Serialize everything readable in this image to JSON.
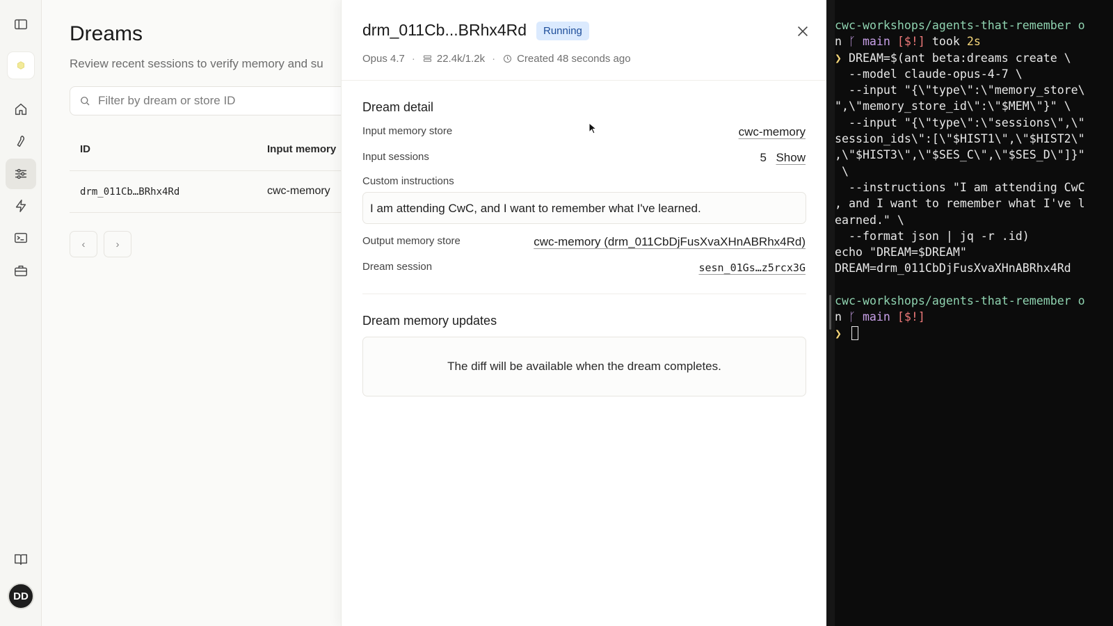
{
  "rail": {
    "items": [
      "sidebar-toggle",
      "logo",
      "home",
      "tools",
      "dreams",
      "bolt",
      "terminal",
      "briefcase",
      "docs"
    ],
    "avatar_initials": "DD"
  },
  "list": {
    "title": "Dreams",
    "subtitle": "Review recent sessions to verify memory and su",
    "search_placeholder": "Filter by dream or store ID",
    "columns": [
      "ID",
      "Input memory"
    ],
    "rows": [
      {
        "id": "drm_011Cb…BRhx4Rd",
        "input_memory": "cwc-memory"
      }
    ],
    "prev_label": "‹",
    "next_label": "›"
  },
  "detail": {
    "title": "drm_011Cb...BRhx4Rd",
    "status": "Running",
    "model": "Opus 4.7",
    "tokens": "22.4k/1.2k",
    "created": "Created 48 seconds ago",
    "section_detail": "Dream detail",
    "input_memory_label": "Input memory store",
    "input_memory_value": "cwc-memory",
    "input_sessions_label": "Input sessions",
    "input_sessions_count": "5",
    "input_sessions_show": "Show",
    "custom_instructions_label": "Custom instructions",
    "custom_instructions_value": "I am attending CwC, and I want to remember what I've learned.",
    "output_memory_label": "Output memory store",
    "output_memory_value": "cwc-memory (drm_011CbDjFusXvaXHnABRhx4Rd)",
    "dream_session_label": "Dream session",
    "dream_session_value": "sesn_01Gs…z5rcx3G",
    "section_updates": "Dream memory updates",
    "diff_message": "The diff will be available when the dream completes."
  },
  "terminal": {
    "prompt_path": "cwc-workshops/agents-that-remember o",
    "prompt_cont": "n ",
    "branch_glyph": "ᚴ",
    "branch": " main ",
    "status": "[$!]",
    "took": " took ",
    "took_time": "2s",
    "arrow": "❯ ",
    "cmd_lines": [
      "DREAM=$(ant beta:dreams create \\",
      "  --model claude-opus-4-7 \\",
      "  --input \"{\\\"type\\\":\\\"memory_store\\",
      "\",\\\"memory_store_id\\\":\\\"$MEM\\\"}\" \\",
      "  --input \"{\\\"type\\\":\\\"sessions\\\",\\\"",
      "session_ids\\\":[\\\"$HIST1\\\",\\\"$HIST2\\\"",
      ",\\\"$HIST3\\\",\\\"$SES_C\\\",\\\"$SES_D\\\"]}\"",
      " \\",
      "  --instructions \"I am attending CwC",
      ", and I want to remember what I've l",
      "earned.\" \\",
      "  --format json | jq -r .id)",
      "echo \"DREAM=$DREAM\"",
      "DREAM=drm_011CbDjFusXvaXHnABRhx4Rd"
    ]
  }
}
